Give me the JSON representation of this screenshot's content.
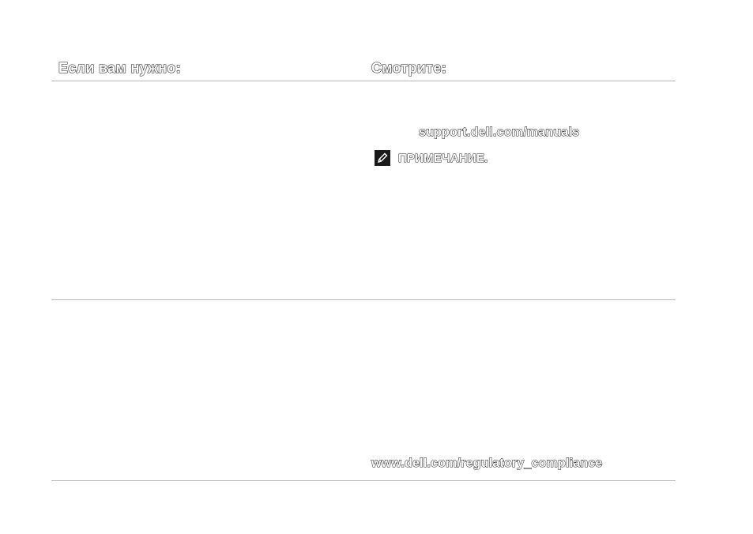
{
  "table": {
    "header_left": "Если вам нужно:",
    "header_right": "Смотрите:"
  },
  "row1": {
    "link": "support.dell.com/manuals",
    "note_label": "ПРИМЕЧАНИЕ."
  },
  "row2": {
    "link": "www.dell.com/regulatory_compliance"
  },
  "icons": {
    "note": "pencil-note-icon"
  }
}
